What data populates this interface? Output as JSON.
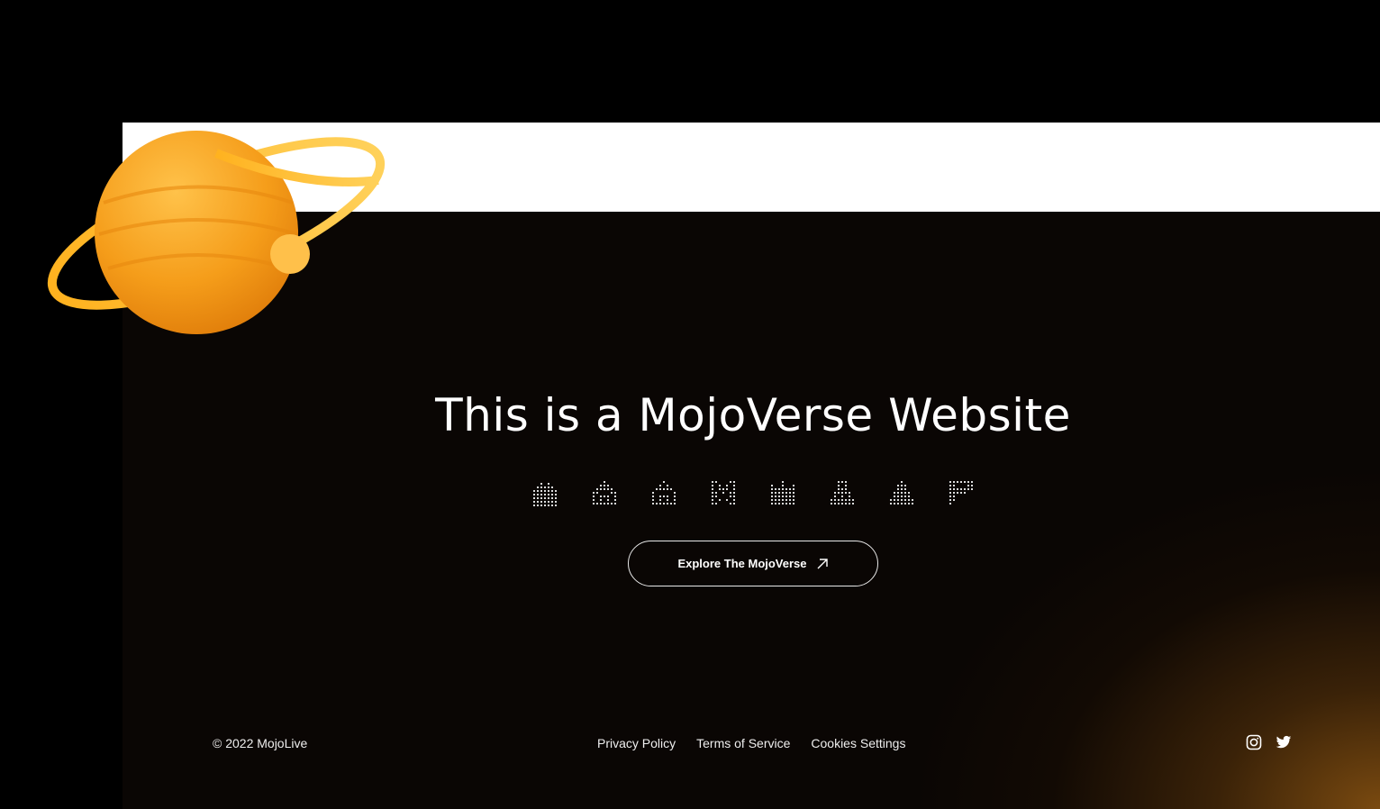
{
  "hero": {
    "title": "This is a MojoVerse Website",
    "cta_label": "Explore The MojoVerse"
  },
  "icons": [
    "pixel-buildings-icon",
    "pixel-temple-icon",
    "pixel-house-icon",
    "pixel-m-logo-icon",
    "pixel-city-icon",
    "pixel-robot-icon",
    "pixel-pyramid-icon",
    "pixel-p-logo-icon"
  ],
  "footer": {
    "copyright": "© 2022 MojoLive",
    "links": [
      "Privacy Policy",
      "Terms of Service",
      "Cookies Settings"
    ],
    "social": [
      "instagram-icon",
      "twitter-icon"
    ]
  },
  "colors": {
    "accent": "#f5a21c",
    "background": "#0a0705",
    "glow": "#7a4a10"
  }
}
